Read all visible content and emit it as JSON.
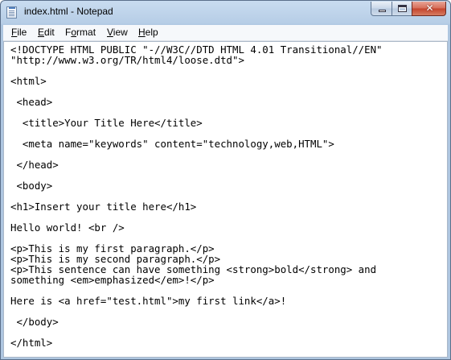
{
  "window": {
    "title": "index.html - Notepad"
  },
  "caption_buttons": {
    "minimize_icon": "minimize-icon",
    "maximize_icon": "maximize-icon",
    "close_glyph": "✕"
  },
  "menu": {
    "items": [
      {
        "accel": "F",
        "rest": "ile"
      },
      {
        "accel": "E",
        "rest": "dit"
      },
      {
        "pre": "F",
        "accel": "o",
        "rest": "rmat"
      },
      {
        "accel": "V",
        "rest": "iew"
      },
      {
        "accel": "H",
        "rest": "elp"
      }
    ]
  },
  "editor": {
    "lines": [
      "<!DOCTYPE HTML PUBLIC \"-//W3C//DTD HTML 4.01 Transitional//EN\"",
      "\"http://www.w3.org/TR/html4/loose.dtd\">",
      "",
      "<html>",
      "",
      " <head>",
      "",
      "  <title>Your Title Here</title>",
      "",
      "  <meta name=\"keywords\" content=\"technology,web,HTML\">",
      "",
      " </head>",
      "",
      " <body>",
      "",
      "<h1>Insert your title here</h1>",
      "",
      "Hello world! <br />",
      "",
      "<p>This is my first paragraph.</p>",
      "<p>This is my second paragraph.</p>",
      "<p>This sentence can have something <strong>bold</strong> and",
      "something <em>emphasized</em>!</p>",
      "",
      "Here is <a href=\"test.html\">my first link</a>!",
      "",
      " </body>",
      "",
      "</html>"
    ]
  }
}
